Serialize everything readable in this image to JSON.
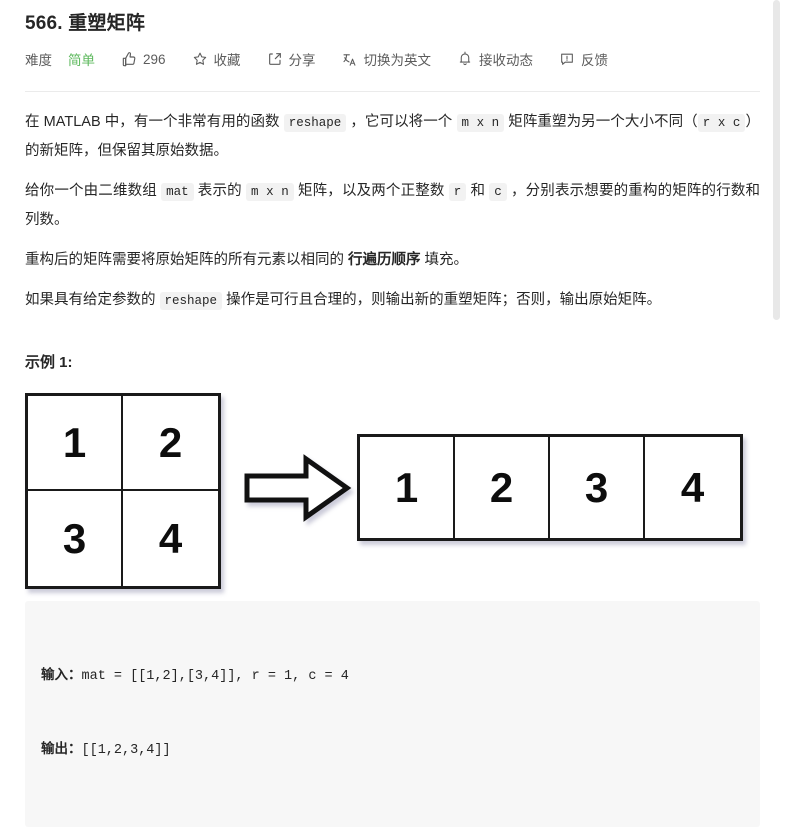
{
  "problem": {
    "number": "566.",
    "title": "重塑矩阵",
    "full_title": "566. 重塑矩阵"
  },
  "toolbar": {
    "difficulty_label": "难度",
    "difficulty_value": "简单",
    "difficulty_color": "#5cb85c",
    "likes_count": "296",
    "favorite_label": "收藏",
    "share_label": "分享",
    "translate_label": "切换为英文",
    "subscribe_label": "接收动态",
    "feedback_label": "反馈",
    "icons": {
      "thumbs_up": "thumbs-up-icon",
      "star": "star-icon",
      "share": "share-icon",
      "translate": "translate-icon",
      "bell": "bell-icon",
      "feedback": "feedback-icon"
    }
  },
  "description": {
    "p1": {
      "t1": "在 MATLAB 中，有一个非常有用的函数 ",
      "c1": "reshape",
      "t2": " ，它可以将一个 ",
      "c2": "m x n",
      "t3": " 矩阵重塑为另一个大小不同（",
      "c3": "r x c",
      "t4": "）的新矩阵，但保留其原始数据。"
    },
    "p2": {
      "t1": "给你一个由二维数组 ",
      "c1": "mat",
      "t2": " 表示的 ",
      "c2": "m x n",
      "t3": " 矩阵，以及两个正整数 ",
      "c3": "r",
      "t4": " 和 ",
      "c4": "c",
      "t5": " ，分别表示想要的重构的矩阵的行数和列数。"
    },
    "p3": {
      "t1": "重构后的矩阵需要将原始矩阵的所有元素以相同的 ",
      "b1": "行遍历顺序",
      "t2": " 填充。"
    },
    "p4": {
      "t1": "如果具有给定参数的 ",
      "c1": "reshape",
      "t2": " 操作是可行且合理的，则输出新的重塑矩阵；否则，输出原始矩阵。"
    }
  },
  "example": {
    "heading": "示例 1:",
    "illustration": {
      "source_matrix": {
        "rows": 2,
        "cols": 2,
        "cells": [
          "1",
          "2",
          "3",
          "4"
        ]
      },
      "arrow": "right-arrow-icon",
      "result_matrix": {
        "rows": 1,
        "cols": 4,
        "cells": [
          "1",
          "2",
          "3",
          "4"
        ]
      }
    },
    "code": {
      "input_label": "输入：",
      "input_value": "mat = [[1,2],[3,4]], r = 1, c = 4",
      "output_label": "输出：",
      "output_value": "[[1,2,3,4]]"
    }
  }
}
